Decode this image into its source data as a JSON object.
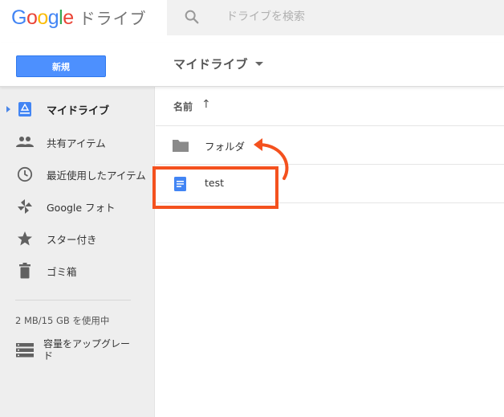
{
  "header": {
    "logo_letters": [
      {
        "ch": "G",
        "color": "#4285f4"
      },
      {
        "ch": "o",
        "color": "#ea4335"
      },
      {
        "ch": "o",
        "color": "#fbbc05"
      },
      {
        "ch": "g",
        "color": "#4285f4"
      },
      {
        "ch": "l",
        "color": "#34a853"
      },
      {
        "ch": "e",
        "color": "#ea4335"
      }
    ],
    "product_name": "ドライブ",
    "search_placeholder": "ドライブを検索"
  },
  "toolbar": {
    "new_button_label": "新規",
    "breadcrumb": "マイドライブ"
  },
  "sidebar": {
    "items": [
      {
        "label": "マイドライブ",
        "icon": "my-drive-icon",
        "active": true
      },
      {
        "label": "共有アイテム",
        "icon": "shared-people-icon",
        "active": false
      },
      {
        "label": "最近使用したアイテム",
        "icon": "clock-icon",
        "active": false
      },
      {
        "label": "Google フォト",
        "icon": "pinwheel-photos-icon",
        "active": false
      },
      {
        "label": "スター付き",
        "icon": "star-icon",
        "active": false
      },
      {
        "label": "ゴミ箱",
        "icon": "trash-icon",
        "active": false
      }
    ],
    "storage_text": "2 MB/15 GB を使用中",
    "upgrade_label": "容量をアップグレード"
  },
  "file_list": {
    "sort_column_label": "名前",
    "sort_direction_symbol": "↑",
    "files": [
      {
        "name": "フォルダ",
        "icon": "folder-icon"
      },
      {
        "name": "test",
        "icon": "google-doc-icon"
      }
    ]
  },
  "colors": {
    "accent_blue": "#4d90fe",
    "annotation_orange": "#f4511e",
    "sidebar_bg": "#eeeeee"
  }
}
